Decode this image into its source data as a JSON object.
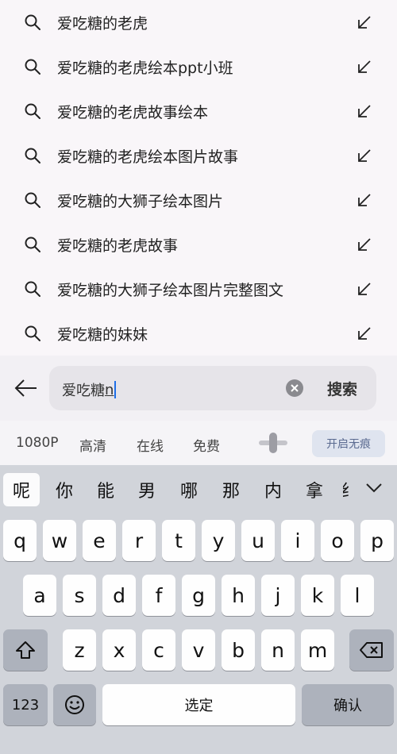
{
  "suggestions": [
    {
      "text": "爱吃糖的老虎"
    },
    {
      "text": "爱吃糖的老虎绘本ppt小班"
    },
    {
      "text": "爱吃糖的老虎故事绘本"
    },
    {
      "text": "爱吃糖的老虎绘本图片故事"
    },
    {
      "text": "爱吃糖的大狮子绘本图片"
    },
    {
      "text": "爱吃糖的老虎故事"
    },
    {
      "text": "爱吃糖的大狮子绘本图片完整图文"
    },
    {
      "text": "爱吃糖的妹妹"
    }
  ],
  "search": {
    "value": "爱吃糖",
    "composing": "n",
    "submit_label": "搜索"
  },
  "filters": {
    "chips": [
      "1080P",
      "高清",
      "在线",
      "免费"
    ],
    "incognito_label": "开启无痕"
  },
  "keyboard": {
    "candidates": [
      "呢",
      "你",
      "能",
      "男",
      "哪",
      "那",
      "内",
      "拿",
      "纟"
    ],
    "row1": [
      "q",
      "w",
      "e",
      "r",
      "t",
      "y",
      "u",
      "i",
      "o",
      "p"
    ],
    "row2": [
      "a",
      "s",
      "d",
      "f",
      "g",
      "h",
      "j",
      "k",
      "l"
    ],
    "row3": [
      "z",
      "x",
      "c",
      "v",
      "b",
      "n",
      "m"
    ],
    "numbers_label": "123",
    "space_label": "选定",
    "confirm_label": "确认"
  },
  "colors": {
    "accent_caret": "#1f6fe8",
    "incognito_bg": "#dfe4ef"
  }
}
